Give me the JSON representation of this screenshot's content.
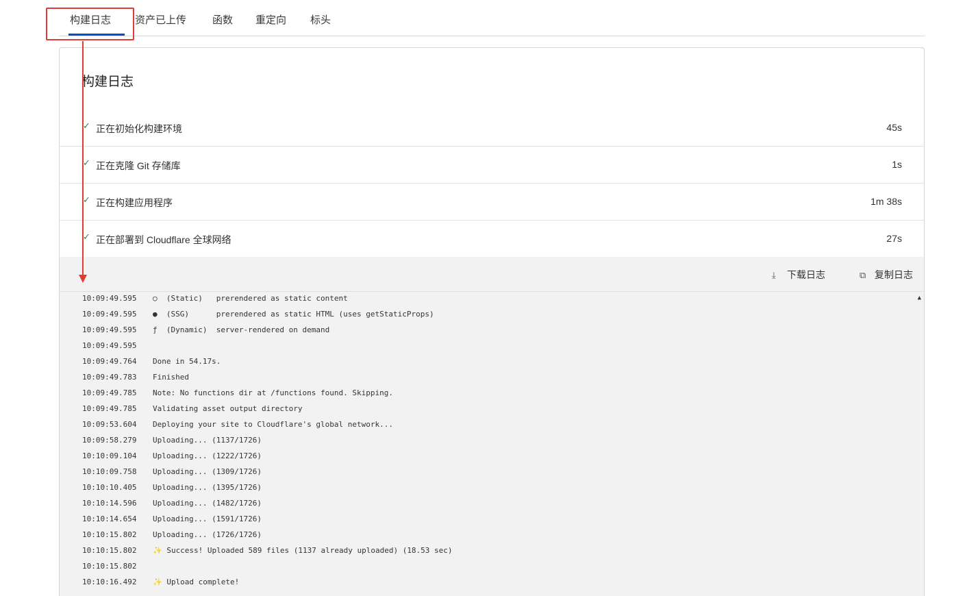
{
  "tabs": [
    {
      "label": "构建日志"
    },
    {
      "label": "资产已上传"
    },
    {
      "label": "函数"
    },
    {
      "label": "重定向"
    },
    {
      "label": "标头"
    }
  ],
  "panel": {
    "title": "构建日志",
    "steps": [
      {
        "label": "正在初始化构建环境",
        "time": "45s"
      },
      {
        "label": "正在克隆 Git 存储库",
        "time": "1s"
      },
      {
        "label": "正在构建应用程序",
        "time": "1m 38s"
      },
      {
        "label": "正在部署到 Cloudflare 全球网络",
        "time": "27s"
      }
    ],
    "toolbar": {
      "download_label": "下载日志",
      "copy_label": "复制日志"
    },
    "log_lines": [
      {
        "ts": "10:09:49.595",
        "msg": "○  (Static)   prerendered as static content"
      },
      {
        "ts": "10:09:49.595",
        "msg": "●  (SSG)      prerendered as static HTML (uses getStaticProps)"
      },
      {
        "ts": "10:09:49.595",
        "msg": "ƒ  (Dynamic)  server-rendered on demand"
      },
      {
        "ts": "10:09:49.595",
        "msg": ""
      },
      {
        "ts": "10:09:49.764",
        "msg": "Done in 54.17s."
      },
      {
        "ts": "10:09:49.783",
        "msg": "Finished"
      },
      {
        "ts": "10:09:49.785",
        "msg": "Note: No functions dir at /functions found. Skipping."
      },
      {
        "ts": "10:09:49.785",
        "msg": "Validating asset output directory"
      },
      {
        "ts": "10:09:53.604",
        "msg": "Deploying your site to Cloudflare's global network..."
      },
      {
        "ts": "10:09:58.279",
        "msg": "Uploading... (1137/1726)"
      },
      {
        "ts": "10:10:09.104",
        "msg": "Uploading... (1222/1726)"
      },
      {
        "ts": "10:10:09.758",
        "msg": "Uploading... (1309/1726)"
      },
      {
        "ts": "10:10:10.405",
        "msg": "Uploading... (1395/1726)"
      },
      {
        "ts": "10:10:14.596",
        "msg": "Uploading... (1482/1726)"
      },
      {
        "ts": "10:10:14.654",
        "msg": "Uploading... (1591/1726)"
      },
      {
        "ts": "10:10:15.802",
        "msg": "Uploading... (1726/1726)"
      },
      {
        "ts": "10:10:15.802",
        "msg": "✨ Success! Uploaded 589 files (1137 already uploaded) (18.53 sec)"
      },
      {
        "ts": "10:10:15.802",
        "msg": ""
      },
      {
        "ts": "10:10:16.492",
        "msg": "✨ Upload complete!"
      }
    ]
  },
  "colors": {
    "accent": "#0051c3",
    "check": "#2e8540",
    "annotation": "#e53935",
    "log_bg": "#f2f2f2"
  },
  "icons": {
    "step": "check-icon",
    "download": "download-icon",
    "copy": "copy-icon",
    "scroll": "scroll-up-icon"
  }
}
